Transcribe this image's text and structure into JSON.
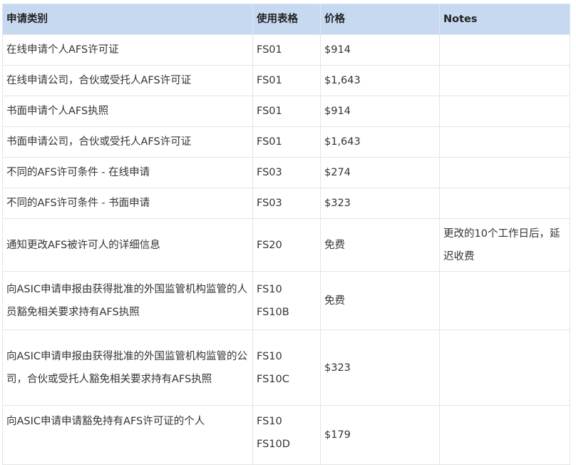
{
  "table": {
    "headers": {
      "type": "申请类别",
      "form": "使用表格",
      "price": "价格",
      "notes": "Notes"
    },
    "rows": [
      {
        "type": "在线申请个人AFS许可证",
        "form": [
          "FS01"
        ],
        "price": "$914",
        "notes": ""
      },
      {
        "type": "在线申请公司，合伙或受托人AFS许可证",
        "form": [
          "FS01"
        ],
        "price": "$1,643",
        "notes": ""
      },
      {
        "type": "书面申请个人AFS执照",
        "form": [
          "FS01"
        ],
        "price": "$914",
        "notes": ""
      },
      {
        "type": "书面申请公司，合伙或受托人AFS许可证",
        "form": [
          "FS01"
        ],
        "price": "$1,643",
        "notes": ""
      },
      {
        "type": "不同的AFS许可条件 - 在线申请",
        "form": [
          "FS03"
        ],
        "price": "$274",
        "notes": ""
      },
      {
        "type": "不同的AFS许可条件 - 书面申请",
        "form": [
          "FS03"
        ],
        "price": "$323",
        "notes": ""
      },
      {
        "type": "通知更改AFS被许可人的详细信息",
        "form": [
          "FS20"
        ],
        "price": "免费",
        "notes": "更改的10个工作日后，延迟收费"
      },
      {
        "type": "向ASIC申请申报由获得批准的外国监管机构监管的人员豁免相关要求持有AFS执照",
        "form": [
          "FS10",
          "FS10B"
        ],
        "price": "免费",
        "notes": ""
      },
      {
        "type": "向ASIC申请申报由获得批准的外国监管机构监管的公司，合伙或受托人豁免相关要求持有AFS执照",
        "form": [
          "FS10",
          "FS10C"
        ],
        "price": "$323",
        "notes": ""
      },
      {
        "type": "向ASIC申请申请豁免持有AFS许可证的个人",
        "form": [
          "FS10",
          "FS10D"
        ],
        "price": "$179",
        "notes": ""
      }
    ]
  }
}
